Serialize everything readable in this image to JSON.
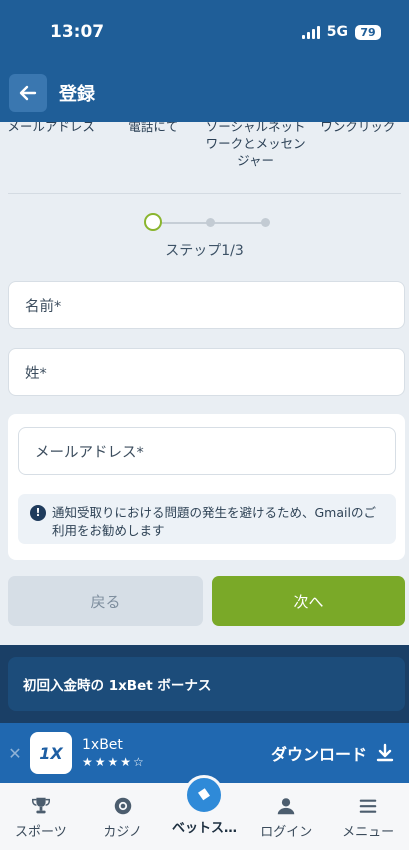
{
  "status_bar": {
    "time": "13:07",
    "network": "5G",
    "battery": "79"
  },
  "header": {
    "title": "登録"
  },
  "methods": [
    {
      "label": "メールアドレス"
    },
    {
      "label": "電話にて"
    },
    {
      "label": "ソーシャルネットワークとメッセンジャー"
    },
    {
      "label": "ワンクリック"
    }
  ],
  "stepper": {
    "label": "ステップ1/3",
    "total": 3,
    "current": 1
  },
  "form": {
    "first_name_placeholder": "名前*",
    "last_name_placeholder": "姓*",
    "email_placeholder": "メールアドレス*",
    "notice_text": "通知受取りにおける問題の発生を避けるため、Gmailのご利用をお勧めします"
  },
  "buttons": {
    "back": "戻る",
    "next": "次へ"
  },
  "bonus": {
    "text": "初回入金時の 1xBet ボーナス"
  },
  "app_banner": {
    "name": "1xBet",
    "logo_text": "1X",
    "rating": 4.5,
    "download": "ダウンロード"
  },
  "tabs": [
    {
      "label": "スポーツ",
      "icon": "trophy-icon"
    },
    {
      "label": "カジノ",
      "icon": "chip-icon"
    },
    {
      "label": "ベットス…",
      "icon": "ticket-icon",
      "active": true
    },
    {
      "label": "ログイン",
      "icon": "user-icon"
    },
    {
      "label": "メニュー",
      "icon": "menu-icon"
    }
  ],
  "colors": {
    "header": "#1f5e98",
    "accent_green": "#7aa928",
    "banner": "#2068b0"
  }
}
